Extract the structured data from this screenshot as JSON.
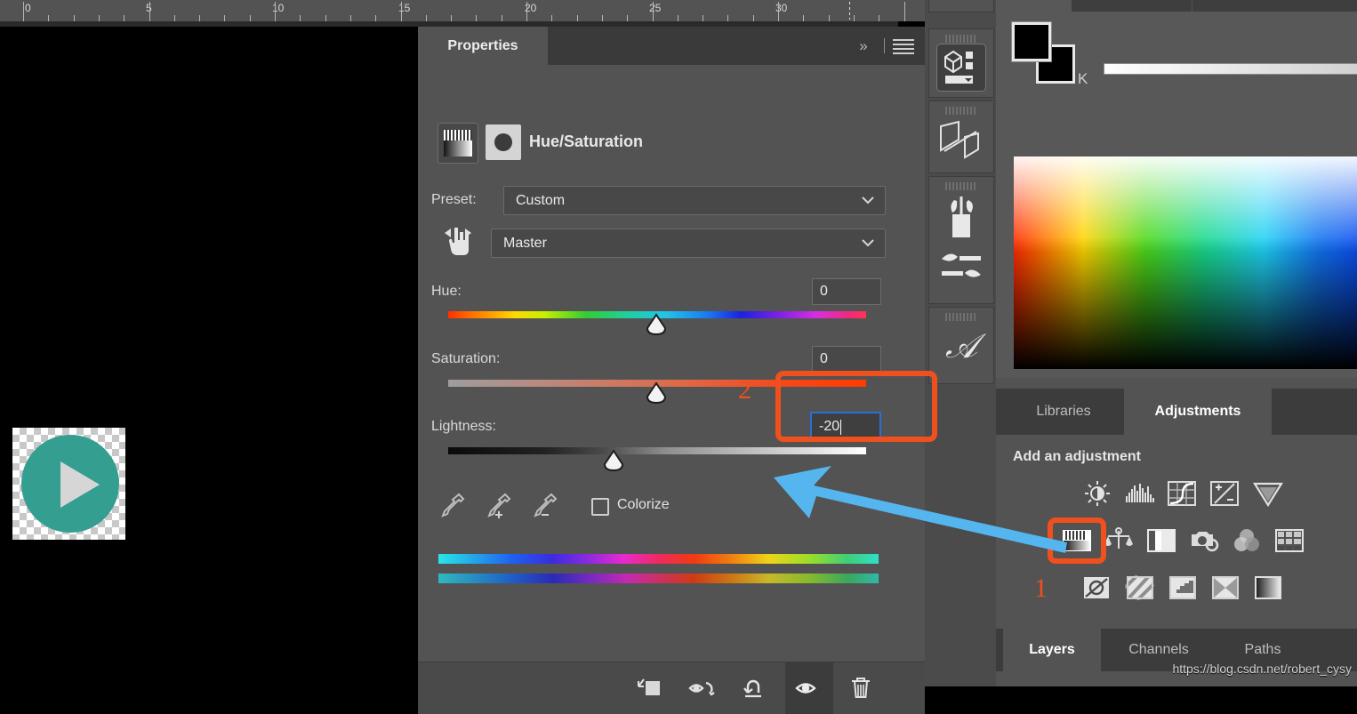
{
  "ruler": {
    "unit_labels": [
      "0",
      "5",
      "10",
      "15",
      "20",
      "25",
      "30"
    ]
  },
  "properties_panel": {
    "tab_label": "Properties",
    "adjustment_title": "Hue/Saturation",
    "preset_label": "Preset:",
    "preset_value": "Custom",
    "channel_value": "Master",
    "sliders": [
      {
        "label": "Hue:",
        "value": "0",
        "thumb_pct": 50
      },
      {
        "label": "Saturation:",
        "value": "0",
        "thumb_pct": 50
      },
      {
        "label": "Lightness:",
        "value": "-20",
        "thumb_pct": 39
      }
    ],
    "colorize_label": "Colorize",
    "colorize_checked": false,
    "footer_icons": [
      "clip-to-layer-icon",
      "toggle-preview-eye-icon",
      "reset-icon",
      "visibility-eye-icon",
      "delete-trash-icon"
    ],
    "header_icons": [
      "expand-chevrons-icon",
      "panel-menu-icon"
    ],
    "eyedropper_icons": [
      "eyedropper-icon",
      "eyedropper-add-icon",
      "eyedropper-subtract-icon"
    ],
    "hand_scrubber_icon": "on-image-adjust-hand-icon"
  },
  "tool_strip": {
    "items": [
      {
        "icon": "shape-tool-icon"
      },
      {
        "icon": "3d-material-drop-icon"
      },
      {
        "icon": "transform-planes-icon"
      },
      {
        "icon": "brushes-jar-icon"
      },
      {
        "icon": "brush-settings-icon"
      },
      {
        "icon": "glyphs-typography-icon"
      }
    ]
  },
  "color_panel": {
    "channel_label": "K",
    "foreground_color": "#000000",
    "background_color": "#000000",
    "foreground_swatch_icon": "foreground-color-swatch",
    "background_swatch_icon": "background-color-swatch"
  },
  "adjustments_dock": {
    "tabs": [
      {
        "label": "Libraries",
        "selected": false
      },
      {
        "label": "Adjustments",
        "selected": true
      }
    ],
    "section_title": "Add an adjustment",
    "rows": [
      [
        "brightness-contrast-icon",
        "levels-icon",
        "curves-icon",
        "exposure-icon",
        "vibrance-icon"
      ],
      [
        "hue-saturation-icon",
        "color-balance-icon",
        "black-and-white-icon",
        "photo-filter-icon",
        "channel-mixer-icon",
        "color-lookup-icon"
      ],
      [
        "invert-icon",
        "posterize-icon",
        "threshold-icon",
        "gradient-map-icon",
        "selective-color-icon"
      ]
    ]
  },
  "layers_dock": {
    "tabs": [
      {
        "label": "Layers",
        "selected": true
      },
      {
        "label": "Channels",
        "selected": false
      },
      {
        "label": "Paths",
        "selected": false
      }
    ]
  },
  "annotations": {
    "callout_1": "1",
    "callout_2": "2",
    "highlight_color": "#f0501e",
    "arrow_color": "#55b6ef"
  },
  "watermark": {
    "text": "https://blog.csdn.net/robert_cysy"
  },
  "media": {
    "play_button_icon": "play-button-icon",
    "play_button_color": "#349e91"
  }
}
